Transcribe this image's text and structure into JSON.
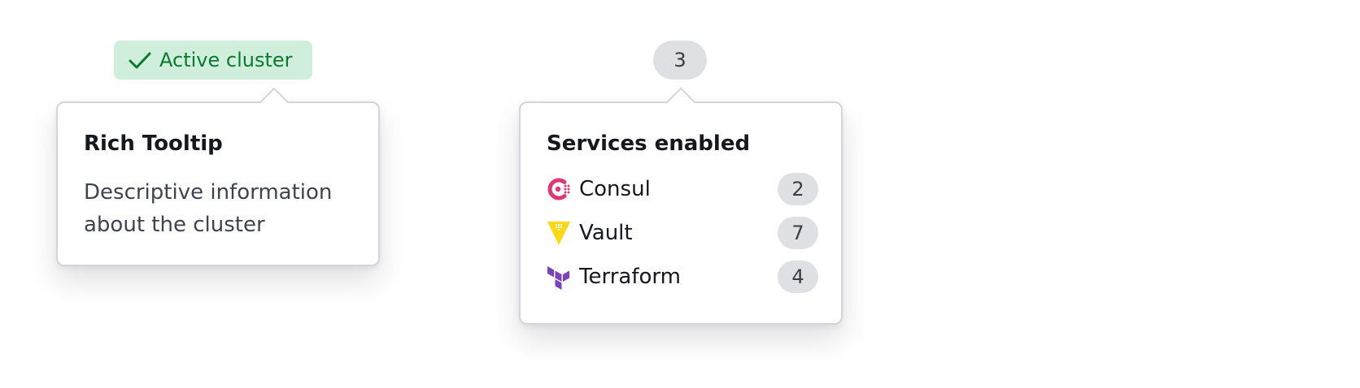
{
  "badges": {
    "active_cluster": "Active cluster",
    "count": "3"
  },
  "tooltip_cluster": {
    "title": "Rich Tooltip",
    "description": "Descriptive information about the cluster"
  },
  "tooltip_services": {
    "title": "Services enabled",
    "services": [
      {
        "name": "Consul",
        "count": "2",
        "icon": "consul-icon",
        "color": "#e03875"
      },
      {
        "name": "Vault",
        "count": "7",
        "icon": "vault-icon",
        "color": "#ffd814"
      },
      {
        "name": "Terraform",
        "count": "4",
        "icon": "terraform-icon",
        "color": "#7b42bc"
      }
    ]
  },
  "colors": {
    "success_bg": "#cfeedc",
    "success_fg": "#0b7a2e",
    "neutral_badge": "#dfe0e4"
  }
}
